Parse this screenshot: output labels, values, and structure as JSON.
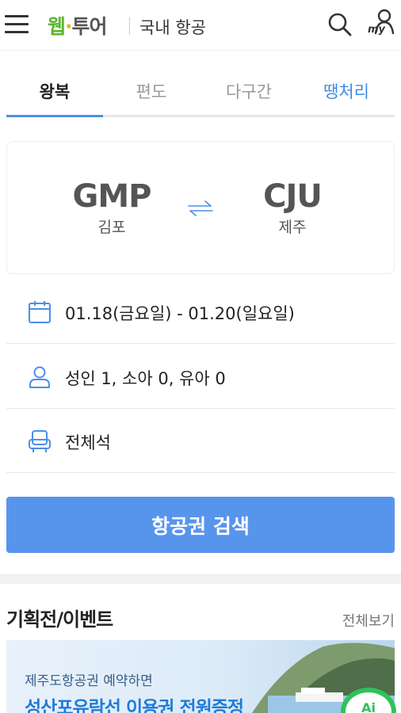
{
  "header": {
    "logo_part1": "웹",
    "logo_dot": "·",
    "logo_part2": "투어",
    "section_title": "국내 항공",
    "my_label": "my"
  },
  "tabs": [
    {
      "label": "왕복",
      "active": true
    },
    {
      "label": "편도",
      "active": false
    },
    {
      "label": "다구간",
      "active": false
    },
    {
      "label": "땡처리",
      "active": false
    }
  ],
  "route": {
    "departure": {
      "code": "GMP",
      "name": "김포"
    },
    "arrival": {
      "code": "CJU",
      "name": "제주"
    }
  },
  "options": {
    "dates": "01.18(금요일) - 01.20(일요일)",
    "passengers": "성인 1, 소아 0, 유아 0",
    "seat_class": "전체석"
  },
  "search_button_label": "항공권 검색",
  "events": {
    "title": "기획전/이벤트",
    "view_all": "전체보기",
    "banner": {
      "subtitle": "제주도항공권 예약하면",
      "headline": "성산포유람선 이용권 전원증정"
    }
  },
  "ai_button_label": "Ai",
  "colors": {
    "brand_green": "#5cb531",
    "accent_blue": "#5795ed",
    "tab_blue": "#3d8be3"
  }
}
